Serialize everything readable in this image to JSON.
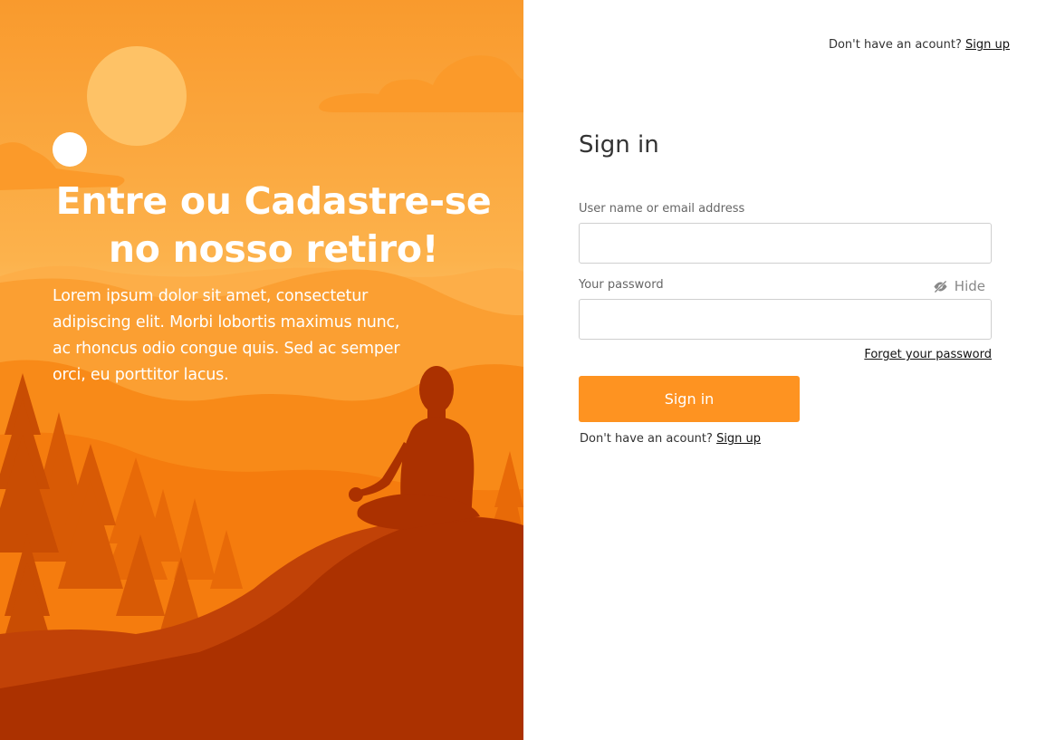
{
  "hero": {
    "title": "Entre ou Cadastre-se no nosso retiro!",
    "body": "Lorem ipsum dolor sit amet, consectetur adipiscing elit. Morbi lobortis maximus nunc, ac rhoncus odio congue quis. Sed ac semper orci, eu porttitor lacus.",
    "illustration": "meditating-person-in-mountains-illustration",
    "colors": {
      "sky_top": "#f99a2d",
      "sun": "#fec266",
      "deep": "#ab3100"
    }
  },
  "header": {
    "signup_prompt": "Don't have an acount?",
    "signup_link": "Sign up"
  },
  "form": {
    "title": "Sign in",
    "username_label": "User name or email address",
    "username_value": "",
    "password_label": "Your password",
    "password_value": "",
    "hide_label": "Hide",
    "hide_icon": "eye-slash-icon",
    "forgot_link": "Forget your password",
    "submit_label": "Sign in",
    "accent_color": "#fe9321"
  },
  "footer": {
    "signup_prompt": "Don't have an acount?",
    "signup_link": "Sign up"
  }
}
